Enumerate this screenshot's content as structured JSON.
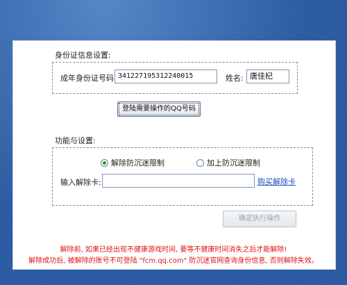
{
  "identity": {
    "section_title": "身份证信息设置:",
    "id_label": "成年身份证号码:",
    "id_value": "341227195312240015",
    "name_label": "姓名:",
    "name_value": "唐佳杞",
    "login_button": "登陆需要操作的QQ号码"
  },
  "functions": {
    "section_title": "功能与设置:",
    "radio_remove": "解除防沉迷限制",
    "radio_remove_checked": true,
    "radio_add": "加上防沉迷限制",
    "radio_add_checked": false,
    "card_label": "输入解除卡:",
    "card_value": "",
    "buy_link": "购买解除卡",
    "execute_button": "确定执行操作"
  },
  "warnings": {
    "line1": "解除前, 如果已经出现不健康游戏时间, 要等不健康时间消失之后才能解除!",
    "line2": "解除成功后, 被解除的账号不可登陆 \"fcm.qq.com\" 防沉迷官网查询身份信息, 否则解除失效。"
  },
  "colors": {
    "background": "#2a5aa2",
    "warning": "#e01010",
    "link": "#1a4fbf",
    "radio_dot": "#1a9a1a"
  }
}
